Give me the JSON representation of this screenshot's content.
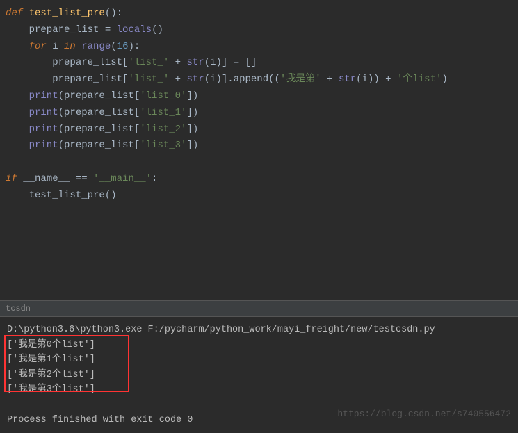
{
  "code": {
    "line1_def": "def",
    "line1_fn": " test_list_pre",
    "line1_rest": "():",
    "line2_assign": "    prepare_list = ",
    "line2_locals": "locals",
    "line2_end": "()",
    "line3_for": "    for",
    "line3_i": " i ",
    "line3_in": "in",
    "line3_range": " range",
    "line3_open": "(",
    "line3_num": "16",
    "line3_close": "):",
    "line4_pre": "        prepare_list[",
    "line4_str": "'list_'",
    "line4_plus": " + ",
    "line4_str2": "str",
    "line4_i": "(i)] = []",
    "line5_pre": "        prepare_list[",
    "line5_str": "'list_'",
    "line5_plus": " + ",
    "line5_str2": "str",
    "line5_mid": "(i)].append((",
    "line5_cn": "'我是第'",
    "line5_plus2": " + ",
    "line5_str3": "str",
    "line5_mid2": "(i)) + ",
    "line5_cn2": "'个list'",
    "line5_end": ")",
    "line6_print": "    print",
    "line6_rest": "(prepare_list[",
    "line6_str": "'list_0'",
    "line6_end": "])",
    "line7_print": "    print",
    "line7_rest": "(prepare_list[",
    "line7_str": "'list_1'",
    "line7_end": "])",
    "line8_print": "    print",
    "line8_rest": "(prepare_list[",
    "line8_str": "'list_2'",
    "line8_end": "])",
    "line9_print": "    print",
    "line9_rest": "(prepare_list[",
    "line9_str": "'list_3'",
    "line9_end": "])",
    "line10_if": "if",
    "line10_name": " __name__ == ",
    "line10_main": "'__main__'",
    "line10_colon": ":",
    "line11": "    test_list_pre()"
  },
  "tab": {
    "label": "tcsdn"
  },
  "console": {
    "cmd": "D:\\python3.6\\python3.exe F:/pycharm/python_work/mayi_freight/new/testcsdn.py",
    "out1": "['我是第0个list']",
    "out2": "['我是第1个list']",
    "out3": "['我是第2个list']",
    "out4": "['我是第3个list']",
    "exit": "Process finished with exit code 0"
  },
  "watermark": "https://blog.csdn.net/s740556472"
}
